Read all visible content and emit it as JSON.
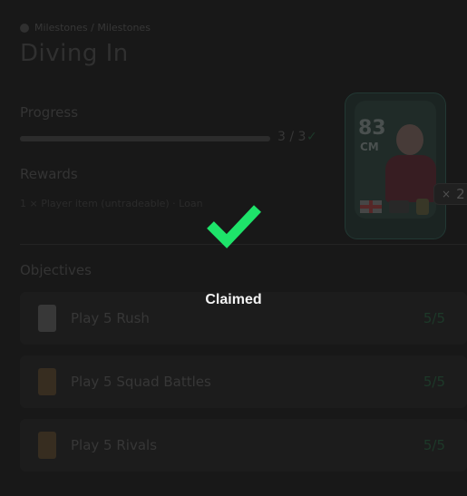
{
  "page": {
    "breadcrumb": "Milestones / Milestones",
    "title": "Diving In"
  },
  "progress": {
    "label": "Progress",
    "value_text": "3 / 3",
    "fraction": 1.0
  },
  "rewards": {
    "label": "Rewards",
    "text": "1 × Player item (untradeable) · Loan"
  },
  "objectives": {
    "label": "Objectives",
    "items": [
      {
        "name": "Play 5 Rush",
        "count": "5/5"
      },
      {
        "name": "Play 5 Squad Battles",
        "count": "5/5"
      },
      {
        "name": "Play 5 Rivals",
        "count": "5/5"
      }
    ]
  },
  "card": {
    "rating": "83",
    "position": "CM"
  },
  "multiplier": {
    "symbol": "×",
    "count": "2"
  },
  "status": {
    "claimed_label": "Claimed"
  },
  "colors": {
    "accent_green": "#1ee36a",
    "background": "#1a1a1a"
  }
}
